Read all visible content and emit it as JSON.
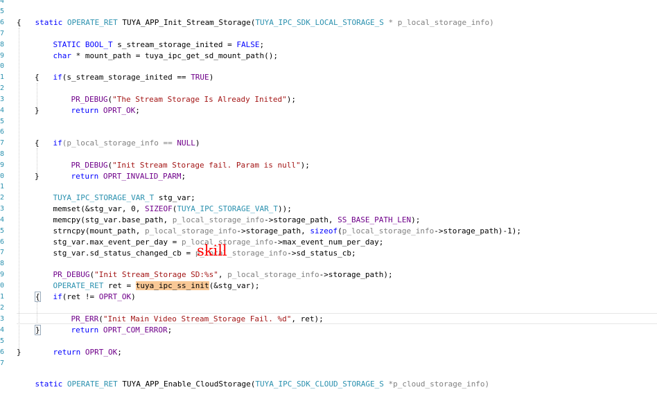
{
  "gutter_numbers": [
    "4",
    "5",
    "6",
    "7",
    "8",
    "9",
    "0",
    "1",
    "2",
    "3",
    "4",
    "5",
    "6",
    "7",
    "8",
    "9",
    "0",
    "1",
    "2",
    "3",
    "4",
    "5",
    "6",
    "7",
    "8",
    "9",
    "0",
    "1",
    "2",
    "3",
    "4",
    "5",
    "6",
    "7"
  ],
  "code": {
    "l1_kw": "static",
    "l1_type": "OPERATE_RET",
    "l1_fn": " TUYA_APP_Init_Stream_Storage(",
    "l1_ptype": "TUYA_IPC_SDK_LOCAL_STORAGE_S",
    "l1_rest": " * p_local_storage_info)",
    "l2": "{",
    "l3_kw": "STATIC BOOL_T",
    "l3_rest": " s_stream_storage_inited = ",
    "l3_val": "FALSE",
    "l3_end": ";",
    "l4_kw": "char",
    "l4_rest": " * mount_path = tuya_ipc_get_sd_mount_path();",
    "l5_kw": "if",
    "l5_rest": "(s_stream_storage_inited == ",
    "l5_val": "TRUE",
    "l5_end": ")",
    "l6": "{",
    "l7_mac": "PR_DEBUG",
    "l7_str": "\"The Stream Storage Is Already Inited\"",
    "l7_end": ");",
    "l8_kw": "return",
    "l8_mac": "OPRT_OK",
    "l8_end": ";",
    "l9": "}",
    "l10_kw": "if",
    "l10_rest": "(p_local_storage_info == ",
    "l10_val": "NULL",
    "l10_end": ")",
    "l11": "{",
    "l12_mac": "PR_DEBUG",
    "l12_str": "\"Init Stream Storage fail. Param is null\"",
    "l12_end": ");",
    "l13_kw": "return",
    "l13_mac": "OPRT_INVALID_PARM",
    "l13_end": ";",
    "l14": "}",
    "l15_type": "TUYA_IPC_STORAGE_VAR_T",
    "l15_rest": " stg_var;",
    "l16_a": "memset(&stg_var, 0, ",
    "l16_mac": "SIZEOF",
    "l16_b": "(",
    "l16_type": "TUYA_IPC_STORAGE_VAR_T",
    "l16_end": "));",
    "l17_a": "memcpy(stg_var.base_path, ",
    "l17_p": "p_local_storage_info",
    "l17_b": "->storage_path, ",
    "l17_mac": "SS_BASE_PATH_LEN",
    "l17_end": ");",
    "l18_a": "strncpy(mount_path, ",
    "l18_p": "p_local_storage_info",
    "l18_b": "->storage_path, ",
    "l18_kw": "sizeof",
    "l18_c": "(",
    "l18_p2": "p_local_storage_info",
    "l18_end": "->storage_path)-1);",
    "l19_a": "stg_var.max_event_per_day = ",
    "l19_p": "p_local_storage_info",
    "l19_end": "->max_event_num_per_day;",
    "l20_a": "stg_var.sd_status_changed_cb = ",
    "l20_p": "p_local_storage_info",
    "l20_end": "->sd_status_cb;",
    "l21_mac": "PR_DEBUG",
    "l21_str": "\"Init Stream_Storage SD:%s\"",
    "l21_b": ", ",
    "l21_p": "p_local_storage_info",
    "l21_end": "->storage_path);",
    "l22_type": "OPERATE_RET",
    "l22_a": " ret = ",
    "l22_fn": "tuya_ipc_ss_init",
    "l22_end": "(&stg_var);",
    "l23_kw": "if",
    "l23_a": "(ret != ",
    "l23_mac": "OPRT_OK",
    "l23_end": ")",
    "l24": "{",
    "l25_mac": "PR_ERR",
    "l25_str": "\"Init Main Video Stream_Storage Fail. %d\"",
    "l25_end": ", ret);",
    "l26_kw": "return",
    "l26_mac": "OPRT_COM_ERROR",
    "l26_end": ";",
    "l27": "}",
    "l28_kw": "return",
    "l28_mac": "OPRT_OK",
    "l28_end": ";",
    "l29": "}",
    "l30_kw": "static",
    "l30_type": "OPERATE_RET",
    "l30_fn": " TUYA_APP_Enable_CloudStorage(",
    "l30_ptype": "TUYA_IPC_SDK_CLOUD_STORAGE_S",
    "l30_rest": " *p_cloud_storage_info)"
  },
  "annotation": "skill"
}
